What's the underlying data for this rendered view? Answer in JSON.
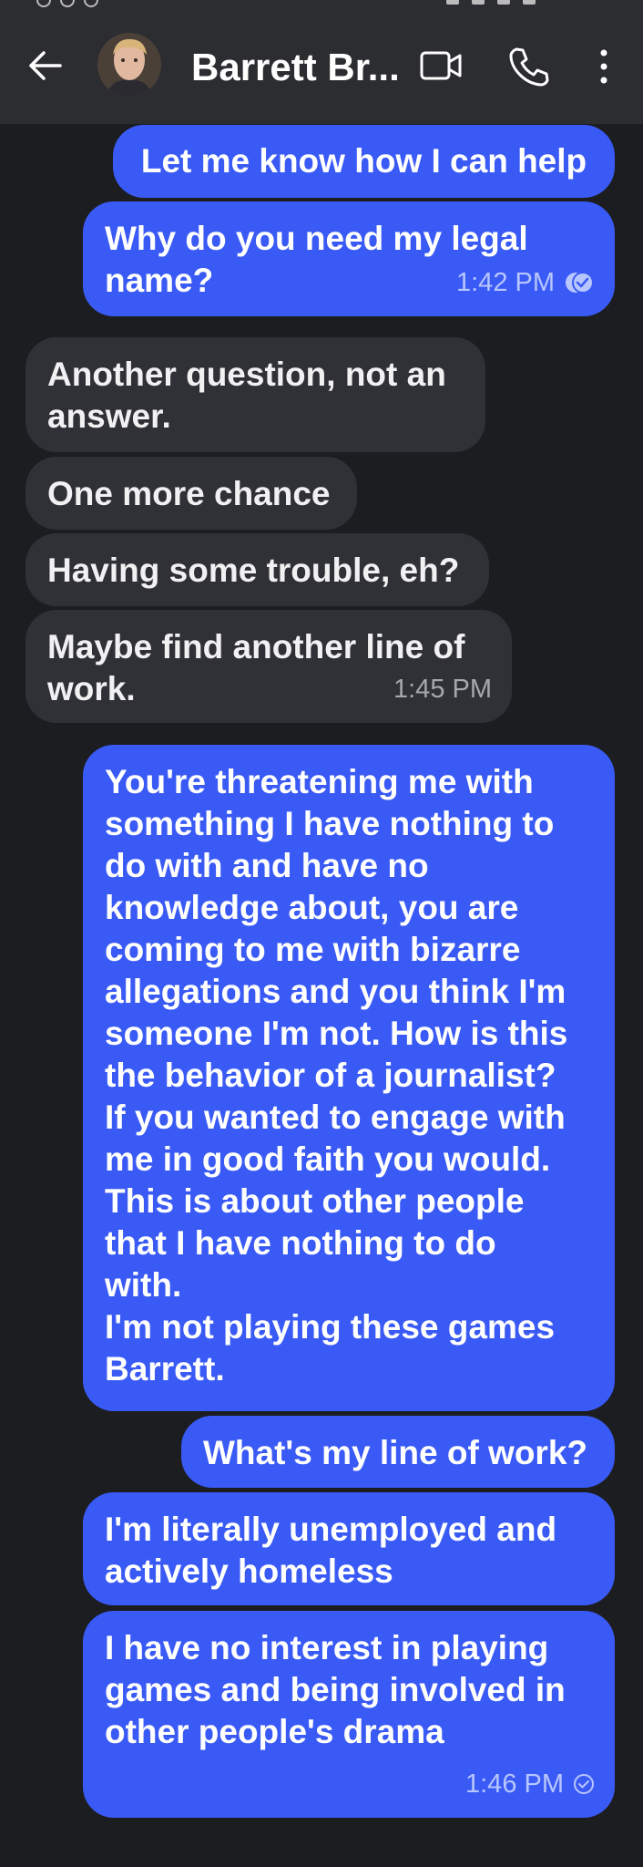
{
  "header": {
    "title": "Barrett Br..."
  },
  "messages": [
    {
      "side": "out",
      "text": "Let me know how I can help"
    },
    {
      "side": "out",
      "text": "Why do you need my legal\nname?",
      "time": "1:42 PM",
      "status_icon": "read-receipt-icon"
    },
    {
      "side": "in",
      "text": "Another question, not an\nanswer."
    },
    {
      "side": "in",
      "text": "One more chance"
    },
    {
      "side": "in",
      "text": "Having some trouble, eh?"
    },
    {
      "side": "in",
      "text": "Maybe find another line of\nwork.",
      "time": "1:45 PM"
    },
    {
      "side": "out",
      "text": "You're threatening me with\nsomething I have nothing to\ndo with and have no\nknowledge about, you are\ncoming to me with bizarre\nallegations and you think I'm\nsomeone I'm not. How is this\nthe behavior of a journalist?\nIf you wanted to engage with\nme in good faith you would.\nThis is about other people\nthat I have nothing to do\nwith.\nI'm not playing these games\nBarrett."
    },
    {
      "side": "out",
      "text": "What's my line of work?"
    },
    {
      "side": "out",
      "text": "I'm literally unemployed and\nactively homeless"
    },
    {
      "side": "out",
      "text": "I have no interest in playing\ngames and being involved in\nother people's drama",
      "time": "1:46 PM",
      "status_icon": "delivered-check-icon"
    }
  ],
  "colors": {
    "background": "#1c1d21",
    "header": "#2c2d31",
    "outgoing_bubble": "#3a5af5",
    "incoming_bubble": "#303136"
  }
}
